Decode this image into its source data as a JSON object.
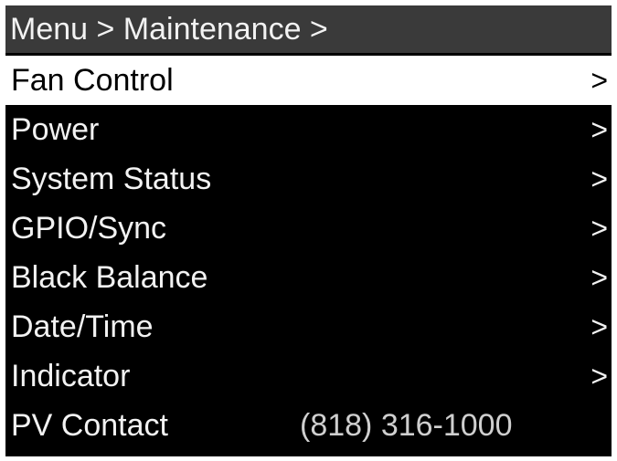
{
  "header": {
    "breadcrumb": "Menu > Maintenance >"
  },
  "menu": {
    "items": [
      {
        "label": "Fan Control",
        "chevron": ">",
        "selected": true
      },
      {
        "label": "Power",
        "chevron": ">"
      },
      {
        "label": "System Status",
        "chevron": ">"
      },
      {
        "label": "GPIO/Sync",
        "chevron": ">"
      },
      {
        "label": "Black Balance",
        "chevron": ">"
      },
      {
        "label": "Date/Time",
        "chevron": ">"
      },
      {
        "label": "Indicator",
        "chevron": ">"
      }
    ],
    "contact": {
      "label": "PV Contact",
      "value": "(818) 316-1000"
    }
  },
  "colors": {
    "background": "#000000",
    "header_bg": "#3a3a3a",
    "text": "#f2f2f2",
    "selected_bg": "#ffffff",
    "selected_text": "#000000"
  }
}
